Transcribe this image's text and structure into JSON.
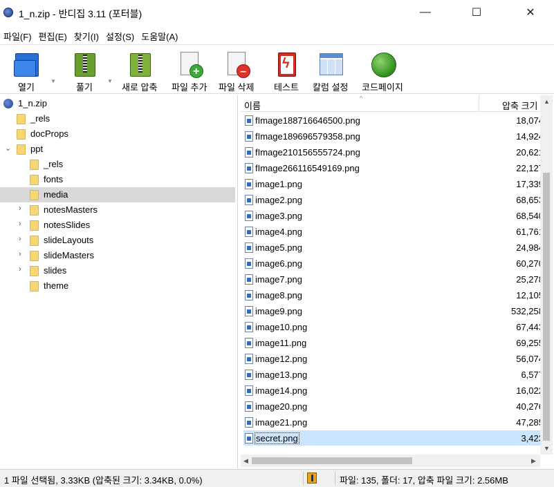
{
  "window": {
    "title": "1_n.zip - 반디집 3.11 (포터블)",
    "minimize": "—",
    "maximize": "☐",
    "close": "✕"
  },
  "menu": [
    "파일(F)",
    "편집(E)",
    "찾기(I)",
    "설정(S)",
    "도움말(A)"
  ],
  "toolbar": {
    "open": "열기",
    "extract": "풀기",
    "new_archive": "새로 압축",
    "add_file": "파일 추가",
    "delete_file": "파일 삭제",
    "test": "테스트",
    "column_settings": "칼럼 설정",
    "codepage": "코드페이지"
  },
  "tree": {
    "root": "1_n.zip",
    "items": [
      {
        "label": "_rels"
      },
      {
        "label": "docProps"
      },
      {
        "label": "ppt"
      },
      {
        "label": "_rels"
      },
      {
        "label": "fonts"
      },
      {
        "label": "media"
      },
      {
        "label": "notesMasters"
      },
      {
        "label": "notesSlides"
      },
      {
        "label": "slideLayouts"
      },
      {
        "label": "slideMasters"
      },
      {
        "label": "slides"
      },
      {
        "label": "theme"
      }
    ]
  },
  "list": {
    "col_name": "이름",
    "col_size": "압축 크기",
    "files": [
      {
        "name": "fImage188716646500.png",
        "size": "18,074"
      },
      {
        "name": "fImage189696579358.png",
        "size": "14,924"
      },
      {
        "name": "fImage210156555724.png",
        "size": "20,621"
      },
      {
        "name": "fImage266116549169.png",
        "size": "22,127"
      },
      {
        "name": "image1.png",
        "size": "17,339"
      },
      {
        "name": "image2.png",
        "size": "68,653"
      },
      {
        "name": "image3.png",
        "size": "68,540"
      },
      {
        "name": "image4.png",
        "size": "61,761"
      },
      {
        "name": "image5.png",
        "size": "24,984"
      },
      {
        "name": "image6.png",
        "size": "60,270"
      },
      {
        "name": "image7.png",
        "size": "25,278"
      },
      {
        "name": "image8.png",
        "size": "12,105"
      },
      {
        "name": "image9.png",
        "size": "532,258"
      },
      {
        "name": "image10.png",
        "size": "67,443"
      },
      {
        "name": "image11.png",
        "size": "69,255"
      },
      {
        "name": "image12.png",
        "size": "56,074"
      },
      {
        "name": "image13.png",
        "size": "6,577"
      },
      {
        "name": "image14.png",
        "size": "16,022"
      },
      {
        "name": "image20.png",
        "size": "40,276"
      },
      {
        "name": "image21.png",
        "size": "47,285"
      },
      {
        "name": "secret.png",
        "size": "3,423"
      }
    ]
  },
  "status": {
    "selection": "1 파일 선택됨, 3.33KB (압축된 크기: 3.34KB, 0.0%)",
    "summary": "파일: 135, 폴더: 17, 압축 파일 크기: 2.56MB"
  }
}
